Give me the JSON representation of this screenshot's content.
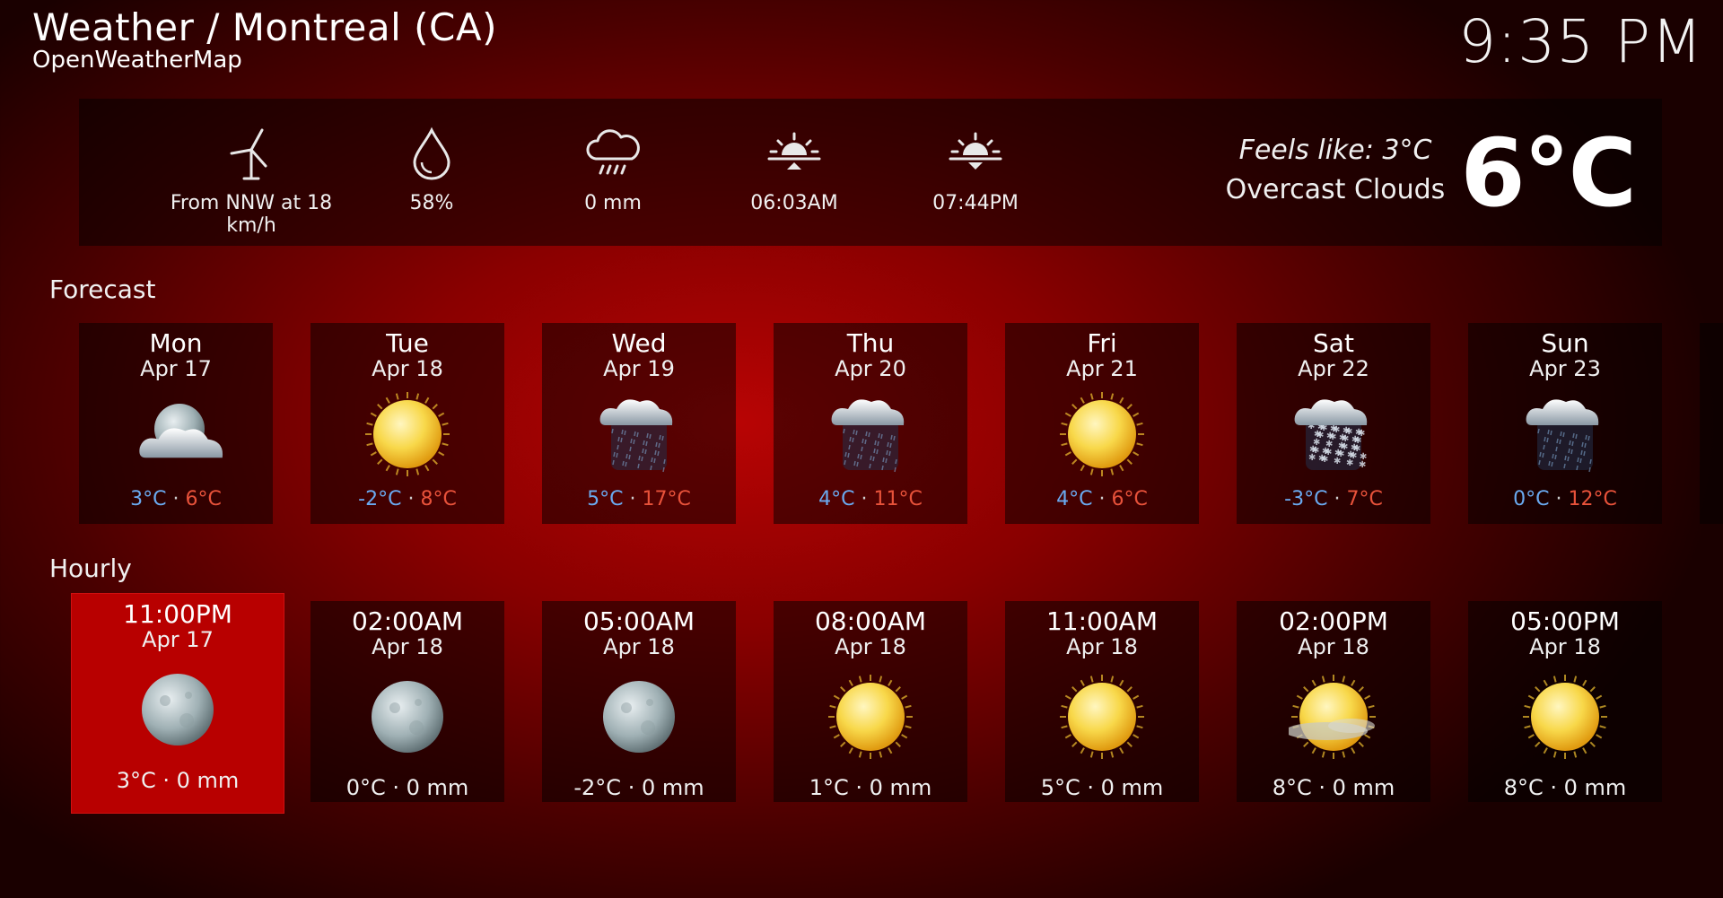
{
  "header": {
    "title": "Weather / Montreal (CA)",
    "subtitle": "OpenWeatherMap",
    "clock": "9:35 PM"
  },
  "current": {
    "wind": "From NNW at 18 km/h",
    "humidity": "58%",
    "precipitation": "0 mm",
    "sunrise": "06:03AM",
    "sunset": "07:44PM",
    "feels_like": "Feels like: 3°C",
    "condition": "Overcast Clouds",
    "temperature": "6°C",
    "icons": [
      "wind-turbine-icon",
      "humidity-drop-icon",
      "rain-cloud-icon",
      "sunrise-icon",
      "sunset-icon"
    ]
  },
  "forecast": {
    "label": "Forecast",
    "days": [
      {
        "day": "Mon",
        "date": "Apr 17",
        "low": "3°C",
        "high": "6°C",
        "icon": "cloudy-moon-icon"
      },
      {
        "day": "Tue",
        "date": "Apr 18",
        "low": "-2°C",
        "high": "8°C",
        "icon": "sun-icon"
      },
      {
        "day": "Wed",
        "date": "Apr 19",
        "low": "5°C",
        "high": "17°C",
        "icon": "rain-cloud-icon"
      },
      {
        "day": "Thu",
        "date": "Apr 20",
        "low": "4°C",
        "high": "11°C",
        "icon": "rain-cloud-icon"
      },
      {
        "day": "Fri",
        "date": "Apr 21",
        "low": "4°C",
        "high": "6°C",
        "icon": "sun-icon"
      },
      {
        "day": "Sat",
        "date": "Apr 22",
        "low": "-3°C",
        "high": "7°C",
        "icon": "snow-cloud-icon"
      },
      {
        "day": "Sun",
        "date": "Apr 23",
        "low": "0°C",
        "high": "12°C",
        "icon": "rain-cloud-icon"
      }
    ],
    "separator": "·"
  },
  "hourly": {
    "label": "Hourly",
    "hours": [
      {
        "time": "11:00PM",
        "date": "Apr 17",
        "summary": "3°C · 0 mm",
        "icon": "moon-icon"
      },
      {
        "time": "02:00AM",
        "date": "Apr 18",
        "summary": "0°C · 0 mm",
        "icon": "moon-icon"
      },
      {
        "time": "05:00AM",
        "date": "Apr 18",
        "summary": "-2°C · 0 mm",
        "icon": "moon-icon"
      },
      {
        "time": "08:00AM",
        "date": "Apr 18",
        "summary": "1°C · 0 mm",
        "icon": "sun-icon"
      },
      {
        "time": "11:00AM",
        "date": "Apr 18",
        "summary": "5°C · 0 mm",
        "icon": "sun-icon"
      },
      {
        "time": "02:00PM",
        "date": "Apr 18",
        "summary": "8°C · 0 mm",
        "icon": "hazy-sun-icon"
      },
      {
        "time": "05:00PM",
        "date": "Apr 18",
        "summary": "8°C · 0 mm",
        "icon": "sun-icon"
      }
    ]
  },
  "colors": {
    "background": "#8a0000",
    "selected": "#b80000",
    "low_temp": "#6aaaf0",
    "high_temp": "#e8523a"
  }
}
